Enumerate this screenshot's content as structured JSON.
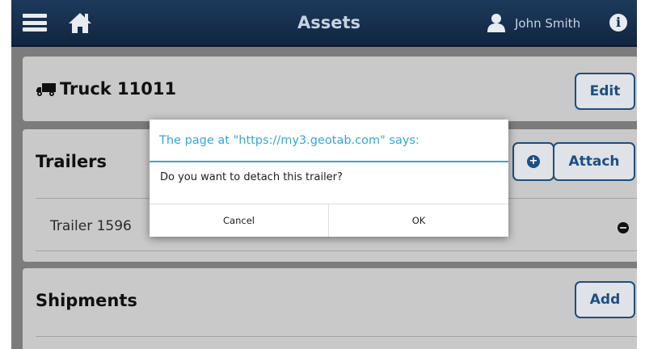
{
  "header": {
    "title": "Assets",
    "user_name": "John Smith",
    "icons": [
      "menu-icon",
      "home-icon",
      "user-icon",
      "info-icon"
    ]
  },
  "vehicle_card": {
    "title": "Truck 11011",
    "icon": "truck-icon",
    "edit_label": "Edit"
  },
  "trailers_card": {
    "heading": "Trailers",
    "attach_label": "Attach",
    "items": [
      {
        "label": "Trailer 1596"
      }
    ]
  },
  "shipments_card": {
    "heading": "Shipments",
    "add_label": "Add"
  },
  "dialog": {
    "title": "The page at \"https://my3.geotab.com\" says:",
    "message": "Do you want to detach this trailer?",
    "cancel_label": "Cancel",
    "ok_label": "OK"
  },
  "colors": {
    "header_bg": "#102640",
    "dialog_accent": "#33a8d7",
    "button_text": "#1b4f85"
  }
}
